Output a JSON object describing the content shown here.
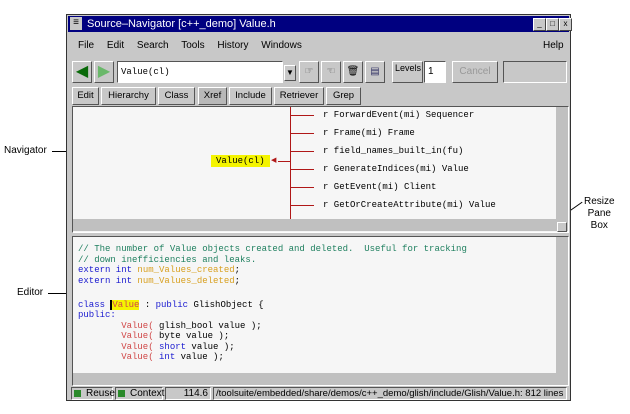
{
  "window": {
    "title": "Source–Navigator [c++_demo] Value.h",
    "controls": [
      "_",
      "□",
      "x"
    ]
  },
  "menu": {
    "items": [
      "File",
      "Edit",
      "Search",
      "Tools",
      "History",
      "Windows"
    ],
    "help": "Help"
  },
  "toolbar": {
    "symbol_value": "Value(cl)",
    "levels_label": "Levels",
    "levels_value": "1",
    "cancel_label": "Cancel"
  },
  "tabs": [
    "Edit",
    "Hierarchy",
    "Class",
    "Xref",
    "Include",
    "Retriever",
    "Grep"
  ],
  "active_tab": "Xref",
  "navigator": {
    "focus": "Value(cl)",
    "refs": [
      "r ForwardEvent(mi) Sequencer",
      "r Frame(mi) Frame",
      "r field_names_built_in(fu)",
      "r GenerateIndices(mi) Value",
      "r GetEvent(mi) Client",
      "r GetOrCreateAttribute(mi) Value"
    ]
  },
  "editor": {
    "lines": [
      [
        {
          "t": "// The number of Value objects created and deleted.  Useful for tracking",
          "c": "c"
        }
      ],
      [
        {
          "t": "// down inefficiencies and leaks.",
          "c": "c"
        }
      ],
      [
        {
          "t": "extern int ",
          "c": "k"
        },
        {
          "t": "num_Values_created",
          "c": "v"
        },
        {
          "t": ";",
          "c": ""
        }
      ],
      [
        {
          "t": "extern int ",
          "c": "k"
        },
        {
          "t": "num_Values_deleted",
          "c": "v"
        },
        {
          "t": ";",
          "c": ""
        }
      ],
      [
        {
          "t": "",
          "c": ""
        }
      ],
      [
        {
          "t": "class ",
          "c": "k"
        },
        {
          "t": "Value",
          "c": "hl"
        },
        {
          "t": " : ",
          "c": ""
        },
        {
          "t": "public ",
          "c": "k"
        },
        {
          "t": "GlishObject {",
          "c": ""
        }
      ],
      [
        {
          "t": "public:",
          "c": "k"
        }
      ],
      [
        {
          "t": "\tValue(",
          "c": "f"
        },
        {
          "t": " glish_bool value );",
          "c": ""
        }
      ],
      [
        {
          "t": "\tValue(",
          "c": "f"
        },
        {
          "t": " byte value );",
          "c": ""
        }
      ],
      [
        {
          "t": "\tValue(",
          "c": "f"
        },
        {
          "t": " short",
          "c": "k"
        },
        {
          "t": " value );",
          "c": ""
        }
      ],
      [
        {
          "t": "\tValue(",
          "c": "f"
        },
        {
          "t": " int",
          "c": "k"
        },
        {
          "t": " value );",
          "c": ""
        }
      ]
    ]
  },
  "status": {
    "reuse": "Reuse",
    "context": "Context",
    "position": "114.6",
    "path": "/toolsuite/embedded/share/demos/c++_demo/glish/include/Glish/Value.h: 812 lines"
  },
  "callouts": {
    "navigator": "Navigator",
    "editor": "Editor",
    "resize": "Resize\nPane\nBox"
  }
}
